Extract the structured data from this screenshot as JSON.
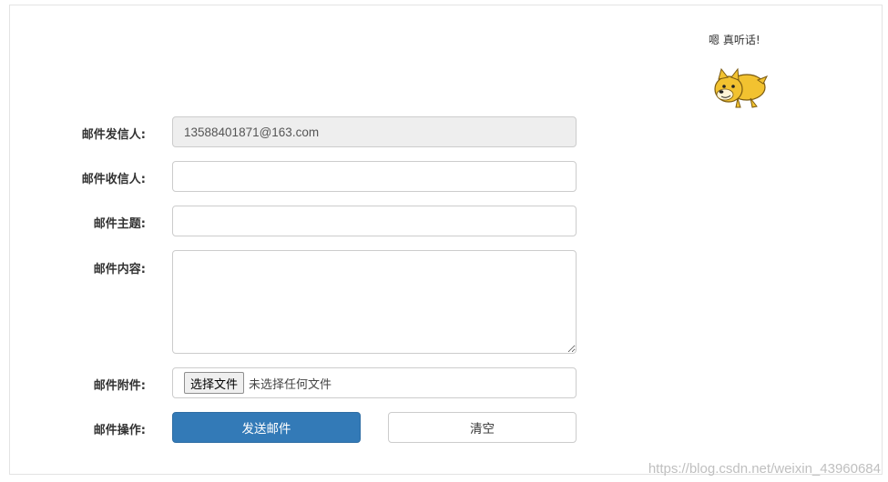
{
  "mascot": {
    "caption": "嗯 真听话!",
    "image": "doge-mascot-icon"
  },
  "form": {
    "sender": {
      "label": "邮件发信人:",
      "value": "13588401871@163.com"
    },
    "recipient": {
      "label": "邮件收信人:",
      "value": "",
      "placeholder": ""
    },
    "subject": {
      "label": "邮件主题:",
      "value": "",
      "placeholder": ""
    },
    "content": {
      "label": "邮件内容:",
      "value": ""
    },
    "attachment": {
      "label": "邮件附件:",
      "button_label": "选择文件",
      "status": "未选择任何文件"
    },
    "actions": {
      "label": "邮件操作:",
      "send_label": "发送邮件",
      "clear_label": "清空"
    }
  },
  "colors": {
    "primary": "#337ab7",
    "border": "#cccccc",
    "readonly_bg": "#eeeeee"
  },
  "watermark": "https://blog.csdn.net/weixin_43960684"
}
